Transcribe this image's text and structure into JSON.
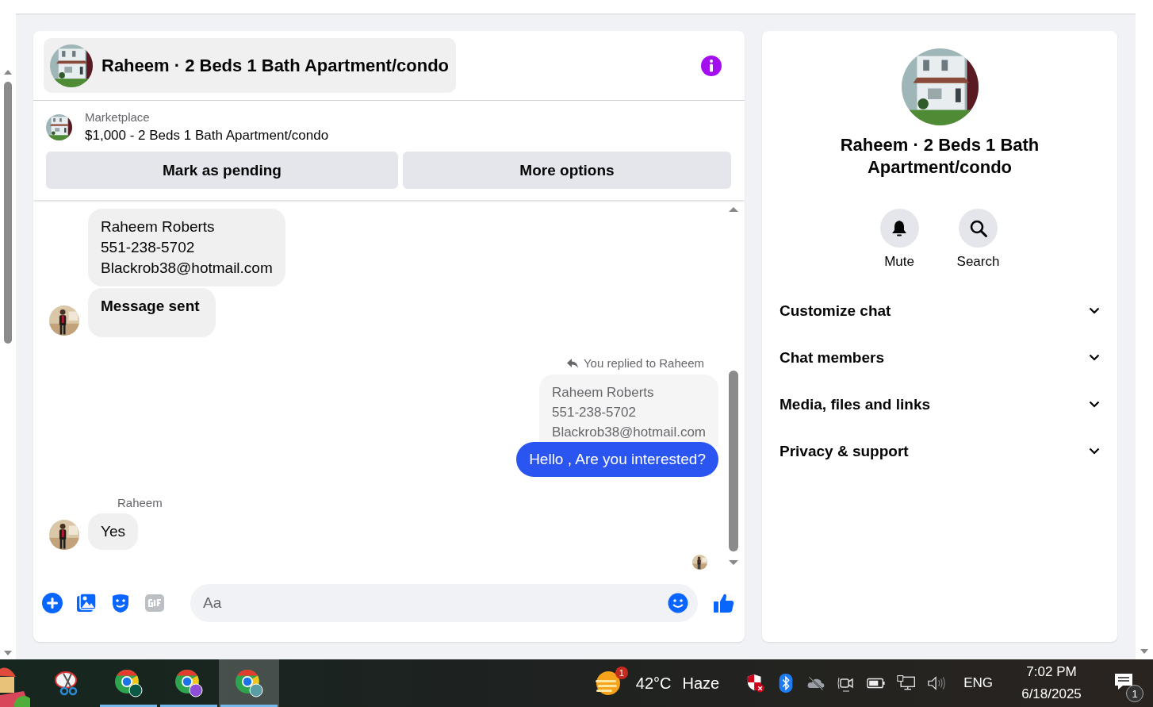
{
  "chat": {
    "title": "Raheem · 2 Beds 1 Bath Apartment/condo",
    "listing": {
      "label": "Marketplace",
      "title": "$1,000 - 2 Beds 1 Bath Apartment/condo"
    },
    "actions": [
      "Mark as pending",
      "More options"
    ],
    "messages": [
      {
        "kind": "incoming",
        "lines": [
          "Raheem Roberts",
          "551-238-5702",
          "Blackrob38@hotmail.com"
        ],
        "avatar": false
      },
      {
        "kind": "notice",
        "text": "Message sent",
        "avatar": true
      },
      {
        "kind": "reply_label",
        "text": "You replied to Raheem"
      },
      {
        "kind": "quote",
        "lines": [
          "Raheem Roberts",
          "551-238-5702",
          "Blackrob38@hotmail.com"
        ]
      },
      {
        "kind": "outgoing",
        "text": "Hello , Are you interested?"
      },
      {
        "kind": "sender",
        "text": "Raheem"
      },
      {
        "kind": "incoming",
        "lines": [
          "Yes"
        ],
        "avatar": true
      },
      {
        "kind": "seen"
      }
    ],
    "composer": {
      "placeholder": "Aa"
    }
  },
  "details": {
    "title": "Raheem · 2 Beds 1 Bath Apartment/condo",
    "actions": [
      {
        "label": "Mute"
      },
      {
        "label": "Search"
      }
    ],
    "sections": [
      {
        "label": "Customize chat",
        "expanded": false
      },
      {
        "label": "Chat members",
        "expanded": false
      },
      {
        "label": "Media, files and links",
        "expanded": false
      },
      {
        "label": "Privacy & support",
        "expanded": false
      }
    ]
  },
  "taskbar": {
    "apps": [
      {
        "kind": "snip",
        "running": false,
        "selected": false
      },
      {
        "kind": "chrome",
        "color": "#0b5a45",
        "running": true,
        "selected": false
      },
      {
        "kind": "chrome",
        "color": "#8e4fd6",
        "running": true,
        "selected": false
      },
      {
        "kind": "chrome",
        "color": "#5a9ea5",
        "running": true,
        "selected": true
      }
    ],
    "weather": {
      "badge": "1",
      "temp": "42°C",
      "condition": "Haze"
    },
    "language": "ENG",
    "time": "7:02 PM",
    "date": "6/18/2025",
    "notifications": "1"
  }
}
